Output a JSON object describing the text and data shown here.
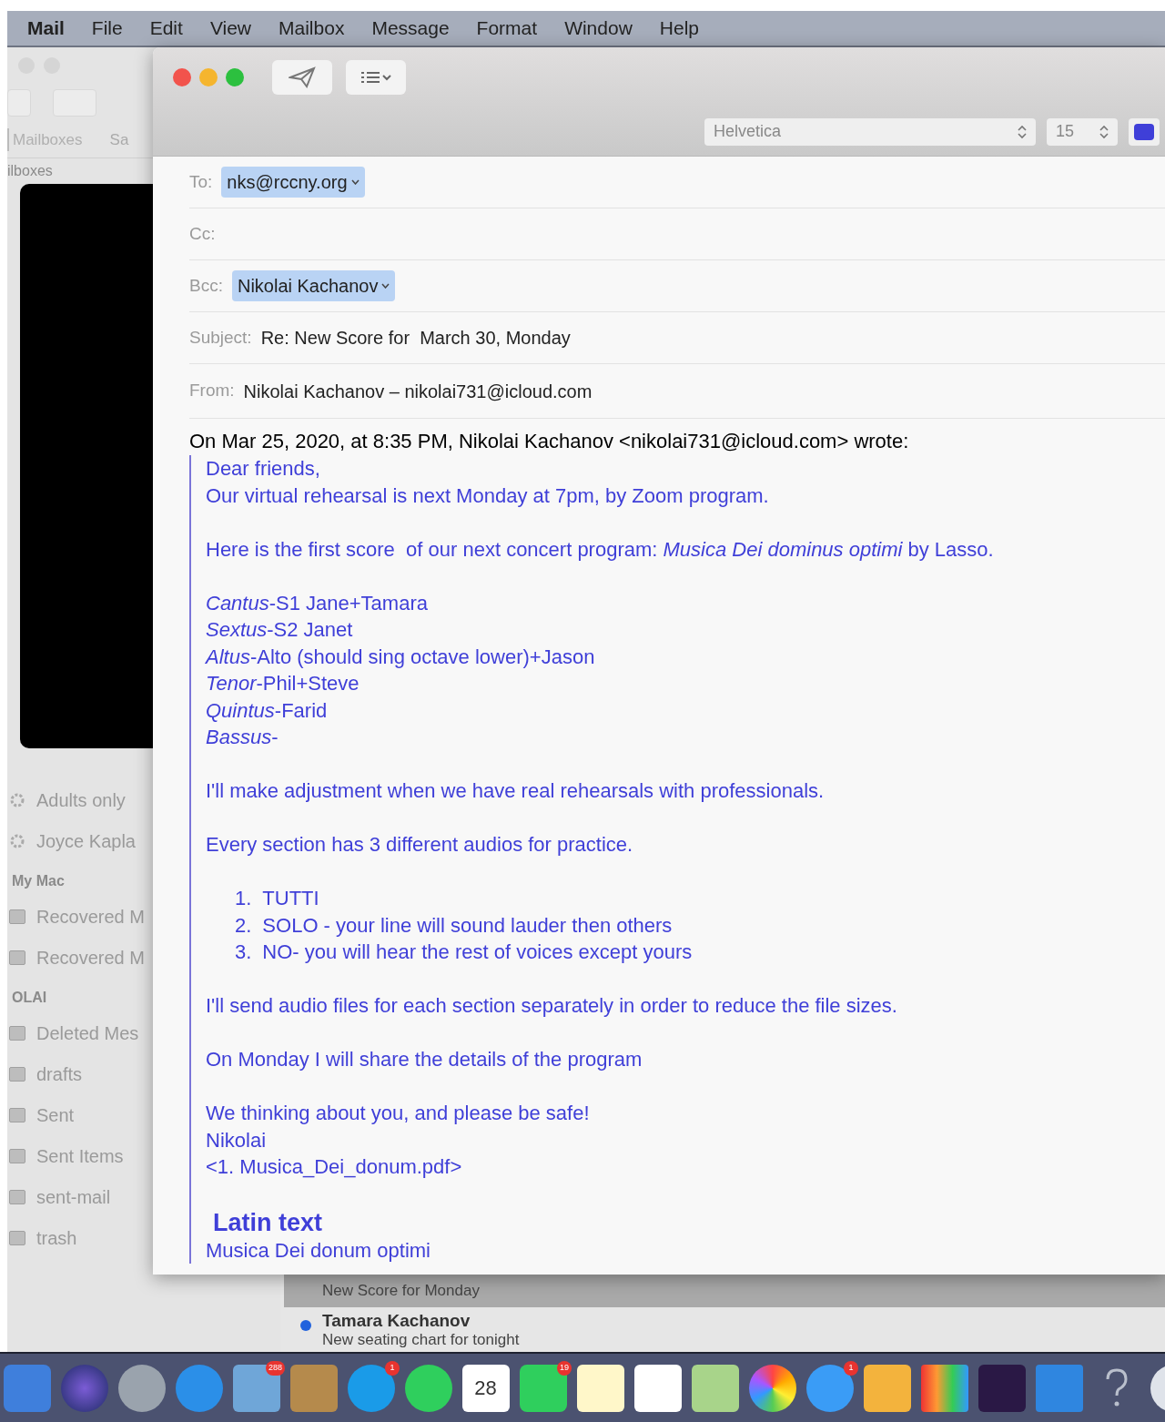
{
  "menu_bar": {
    "app": "Mail",
    "items": [
      "File",
      "Edit",
      "View",
      "Mailbox",
      "Message",
      "Format",
      "Window",
      "Help"
    ]
  },
  "sidebar": {
    "tab": "Mailboxes",
    "tab_cut": "Sa",
    "heading_cut": "ilboxes",
    "groups": [
      {
        "items": [
          {
            "label": "Adults only",
            "kind": "smart"
          },
          {
            "label": "Joyce Kapla",
            "kind": "smart"
          }
        ]
      },
      {
        "heading": "My Mac",
        "items": [
          {
            "label": "Recovered M",
            "kind": "folder"
          },
          {
            "label": "Recovered M",
            "kind": "folder"
          }
        ]
      },
      {
        "heading": "OLAI",
        "items": [
          {
            "label": "Deleted Mes",
            "kind": "folder"
          },
          {
            "label": "drafts",
            "kind": "folder"
          },
          {
            "label": "Sent",
            "kind": "folder"
          },
          {
            "label": "Sent Items",
            "kind": "folder"
          },
          {
            "label": "sent-mail",
            "kind": "folder"
          },
          {
            "label": "trash",
            "kind": "folder"
          }
        ]
      }
    ]
  },
  "message_list": [
    {
      "subject": "New Score for Monday",
      "selected": true
    },
    {
      "sender": "Tamara Kachanov",
      "subject": "New seating chart for tonight",
      "unread": true,
      "selected": false
    }
  ],
  "compose": {
    "font": "Helvetica",
    "size": "15",
    "fields": [
      {
        "label": "To:",
        "tokens": [
          "nks@rccny.org"
        ]
      },
      {
        "label": "Cc:"
      },
      {
        "label": "Bcc:",
        "tokens": [
          "Nikolai Kachanov"
        ]
      },
      {
        "label": "Subject:",
        "value": "Re: New Score for  March 30, Monday"
      },
      {
        "label": "From:",
        "value": "Nikolai Kachanov – nikolai731@icloud.com"
      }
    ],
    "quote_header": "On Mar 25, 2020, at 8:35 PM, Nikolai Kachanov <nikolai731@icloud.com> wrote:",
    "blocks": [
      {
        "kind": "text",
        "lines": [
          "Dear friends,",
          "Our virtual rehearsal is next Monday at 7pm, by Zoom program."
        ]
      },
      {
        "kind": "text",
        "lines": [
          "Here is the first score  of our next concert program: *Musica Dei dominus optimi* by Lasso."
        ]
      },
      {
        "kind": "text",
        "lines": [
          "*Cantus*-S1 Jane+Tamara",
          "*Sextus*-S2 Janet",
          "*Altus*-Alto (should sing octave lower)+Jason",
          "*Tenor*-Phil+Steve",
          "*Quintus*-Farid",
          "*Bassus*-"
        ]
      },
      {
        "kind": "text",
        "lines": [
          "I'll make adjustment when we have real rehearsals with professionals."
        ]
      },
      {
        "kind": "text",
        "lines": [
          "Every section has 3 different audios for practice."
        ]
      },
      {
        "kind": "list",
        "items": [
          {
            "number": "1.",
            "text": "TUTTI"
          },
          {
            "number": "2.",
            "text": "SOLO - your line will sound lauder then others"
          },
          {
            "number": "3.",
            "text": "NO- you will hear the rest of voices except yours"
          }
        ]
      },
      {
        "kind": "text",
        "lines": [
          "I'll send audio files for each section separately in order to reduce the file sizes."
        ]
      },
      {
        "kind": "text",
        "lines": [
          "On Monday I will share the details of the program"
        ]
      },
      {
        "kind": "text",
        "lines": [
          "We thinking about you, and please be safe!",
          "Nikolai",
          "<1. Musica_Dei_donum.pdf>"
        ]
      },
      {
        "kind": "heading",
        "title": "Latin text",
        "lines": [
          "Musica Dei donum optimi"
        ]
      }
    ]
  },
  "dock": [
    {
      "kind": "app"
    },
    {
      "kind": "app"
    },
    {
      "kind": "app"
    },
    {
      "kind": "app"
    },
    {
      "kind": "app",
      "badge": "288"
    },
    {
      "kind": "app"
    },
    {
      "kind": "app",
      "badge": "1"
    },
    {
      "kind": "app"
    },
    {
      "kind": "calendar",
      "label": "28"
    },
    {
      "kind": "app",
      "badge": "19"
    },
    {
      "kind": "app"
    },
    {
      "kind": "app"
    },
    {
      "kind": "app"
    },
    {
      "kind": "app"
    },
    {
      "kind": "app",
      "badge": "1"
    },
    {
      "kind": "app"
    },
    {
      "kind": "app"
    },
    {
      "kind": "app"
    },
    {
      "kind": "app"
    },
    {
      "kind": "help"
    },
    {
      "kind": "app"
    }
  ]
}
